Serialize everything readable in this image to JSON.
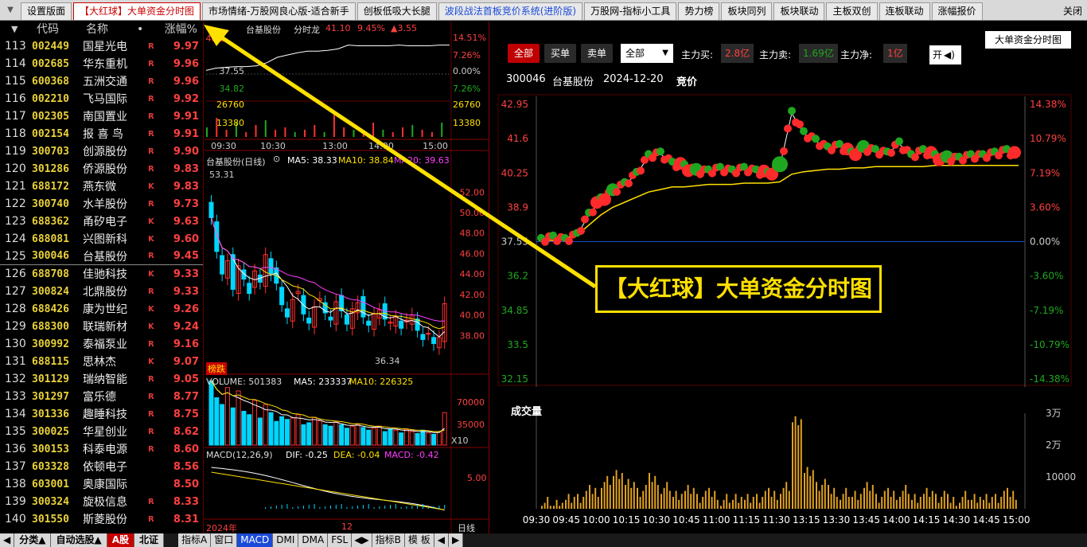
{
  "tabs": [
    {
      "label": "设置版面",
      "state": "normal"
    },
    {
      "label": "【大红球】大单资金分时图",
      "state": "active"
    },
    {
      "label": "市场情绪-万股网良心版-适合新手",
      "state": "normal"
    },
    {
      "label": "创板低吸大长腿",
      "state": "normal"
    },
    {
      "label": "波段战法首板竞价系统(进阶版)",
      "state": "blue"
    },
    {
      "label": "万股网-指标小工具",
      "state": "normal"
    },
    {
      "label": "势力榜",
      "state": "normal"
    },
    {
      "label": "板块同列",
      "state": "normal"
    },
    {
      "label": "板块联动",
      "state": "normal"
    },
    {
      "label": "主板双创",
      "state": "normal"
    },
    {
      "label": "连板联动",
      "state": "normal"
    },
    {
      "label": "涨幅报价",
      "state": "normal"
    }
  ],
  "close_label": "关闭",
  "list": {
    "header": {
      "code": "代码",
      "name": "名称",
      "dot": "•",
      "pct": "涨幅%"
    },
    "rows": [
      {
        "no": "113",
        "code": "002449",
        "name": "国星光电",
        "flag": "R",
        "pct": "9.97"
      },
      {
        "no": "114",
        "code": "002685",
        "name": "华东重机",
        "flag": "R",
        "pct": "9.96"
      },
      {
        "no": "115",
        "code": "600368",
        "name": "五洲交通",
        "flag": "R",
        "pct": "9.96"
      },
      {
        "no": "116",
        "code": "002210",
        "name": "飞马国际",
        "flag": "R",
        "pct": "9.92"
      },
      {
        "no": "117",
        "code": "002305",
        "name": "南国置业",
        "flag": "R",
        "pct": "9.91"
      },
      {
        "no": "118",
        "code": "002154",
        "name": "报 喜 鸟",
        "flag": "R",
        "pct": "9.91"
      },
      {
        "no": "119",
        "code": "300703",
        "name": "创源股份",
        "flag": "R",
        "pct": "9.90"
      },
      {
        "no": "120",
        "code": "301286",
        "name": "侨源股份",
        "flag": "R",
        "pct": "9.83"
      },
      {
        "no": "121",
        "code": "688172",
        "name": "燕东微",
        "flag": "K",
        "pct": "9.83"
      },
      {
        "no": "122",
        "code": "300740",
        "name": "水羊股份",
        "flag": "R",
        "pct": "9.73"
      },
      {
        "no": "123",
        "code": "688362",
        "name": "甬矽电子",
        "flag": "K",
        "pct": "9.63"
      },
      {
        "no": "124",
        "code": "688081",
        "name": "兴图新科",
        "flag": "K",
        "pct": "9.60"
      },
      {
        "no": "125",
        "code": "300046",
        "name": "台基股份",
        "flag": "R",
        "pct": "9.45"
      },
      {
        "no": "126",
        "code": "688708",
        "name": "佳驰科技",
        "flag": "K",
        "pct": "9.33"
      },
      {
        "no": "127",
        "code": "300824",
        "name": "北鼎股份",
        "flag": "R",
        "pct": "9.33"
      },
      {
        "no": "128",
        "code": "688426",
        "name": "康为世纪",
        "flag": "K",
        "pct": "9.26"
      },
      {
        "no": "129",
        "code": "688300",
        "name": "联瑞新材",
        "flag": "K",
        "pct": "9.24"
      },
      {
        "no": "130",
        "code": "300992",
        "name": "泰福泵业",
        "flag": "R",
        "pct": "9.16"
      },
      {
        "no": "131",
        "code": "688115",
        "name": "思林杰",
        "flag": "K",
        "pct": "9.07"
      },
      {
        "no": "132",
        "code": "301129",
        "name": "瑞纳智能",
        "flag": "R",
        "pct": "9.05"
      },
      {
        "no": "133",
        "code": "301297",
        "name": "富乐德",
        "flag": "R",
        "pct": "8.77"
      },
      {
        "no": "134",
        "code": "301336",
        "name": "趣睡科技",
        "flag": "R",
        "pct": "8.75"
      },
      {
        "no": "135",
        "code": "300025",
        "name": "华星创业",
        "flag": "R",
        "pct": "8.62"
      },
      {
        "no": "136",
        "code": "300153",
        "name": "科泰电源",
        "flag": "R",
        "pct": "8.60"
      },
      {
        "no": "137",
        "code": "603328",
        "name": "依顿电子",
        "flag": "",
        "pct": "8.56"
      },
      {
        "no": "138",
        "code": "603001",
        "name": "奥康国际",
        "flag": "",
        "pct": "8.50"
      },
      {
        "no": "139",
        "code": "300324",
        "name": "旋极信息",
        "flag": "R",
        "pct": "8.33"
      },
      {
        "no": "140",
        "code": "301550",
        "name": "斯菱股份",
        "flag": "R",
        "pct": "8.31"
      }
    ]
  },
  "bottom": {
    "left": [
      "分类▲",
      "自动选股▲",
      "A股",
      "北证"
    ],
    "mid": [
      "指标A",
      "窗口",
      "MACD",
      "DMI",
      "DMA",
      "FSL",
      "指标B",
      "模 板"
    ]
  },
  "mini": {
    "title": "台基股份",
    "mode": "分时龙",
    "price": "41.10",
    "pct": "9.45%",
    "chg": "▲3.55",
    "left_prices": [
      "40.2",
      "37.55",
      "34.82"
    ],
    "left_vols": [
      "26760",
      "13380"
    ],
    "right_pcts": [
      "14.51%",
      "7.26%",
      "0.00%",
      "7.26%"
    ],
    "right_vols": [
      "26760",
      "13380"
    ],
    "times": [
      "09:30",
      "10:30",
      "13:00",
      "14:00",
      "15:00"
    ],
    "price_line": [
      37.8,
      38.1,
      38.2,
      38.3,
      38.3,
      38.4,
      38.8,
      39.5,
      39.8,
      40.1,
      40.3,
      40.3,
      40.4,
      40.6,
      41.1,
      41.0,
      41.0,
      41.0,
      41.0,
      41.1,
      41.0,
      41.0,
      41.0,
      41.1,
      41.1
    ],
    "vol_bars": [
      4,
      8,
      3,
      6,
      2,
      5,
      7,
      3,
      4,
      2,
      3,
      5,
      2,
      10,
      4,
      3,
      2,
      6,
      3,
      2,
      4,
      5,
      3,
      2,
      6
    ]
  },
  "kline": {
    "title": "台基股份(日线)",
    "ma5": "MA5: 38.33",
    "ma10": "MA10: 38.84",
    "ma20": "MA20: 39.63",
    "hi": "53.31",
    "lo": "36.34",
    "tag": "榜跌",
    "yticks": [
      "52.00",
      "50.00",
      "48.00",
      "46.00",
      "44.00",
      "42.00",
      "40.00",
      "38.00"
    ],
    "closes": [
      49.5,
      46.2,
      44.0,
      45.3,
      42.5,
      44.8,
      43.5,
      42.1,
      44.3,
      43.2,
      45.9,
      44.0,
      43.1,
      41.0,
      39.8,
      41.5,
      42.3,
      40.1,
      39.2,
      40.8,
      41.6,
      40.2,
      39.5,
      41.3,
      40.4,
      39.1,
      40.6,
      41.2,
      39.8,
      39.0,
      40.1,
      40.5,
      39.6,
      39.3,
      39.8,
      38.7,
      39.5,
      40.0,
      38.5,
      37.6,
      38.2,
      37.2,
      37.8,
      41.1
    ]
  },
  "vol": {
    "title": "VOLUME: 501383",
    "ma5": "MA5: 233337",
    "ma10": "MA10: 226325",
    "yticks": [
      "70000",
      "35000"
    ],
    "unit": "X10",
    "bars": [
      95,
      70,
      60,
      85,
      55,
      80,
      50,
      45,
      66,
      40,
      60,
      48,
      35,
      42,
      38,
      40,
      45,
      30,
      33,
      41,
      36,
      30,
      28,
      34,
      30,
      25,
      28,
      31,
      26,
      22,
      25,
      28,
      20,
      24,
      22,
      18,
      23,
      20,
      17,
      22,
      18,
      16,
      20,
      48
    ]
  },
  "macd": {
    "title": "MACD(12,26,9)",
    "dif": "DIF: -0.25",
    "dea": "DEA: -0.04",
    "macd": "MACD: -0.42",
    "ytick": "5.00",
    "xlabels": [
      "2024年",
      "12"
    ],
    "period": "日线"
  },
  "right": {
    "filters": [
      "全部",
      "买单",
      "卖单"
    ],
    "dropdown": "全部",
    "buy_label": "主力买:",
    "buy_val": "2.8亿",
    "sell_label": "主力卖:",
    "sell_val": "1.69亿",
    "net_label": "主力净:",
    "net_val": "1亿",
    "toggle": "开",
    "title_btn": "大单资金分时图",
    "stock_line": [
      "300046",
      "台基股份",
      "2024-12-20",
      "竞价"
    ],
    "left_ticks": [
      "42.95",
      "41.6",
      "40.25",
      "38.9",
      "37.55",
      "36.2",
      "34.85",
      "33.5",
      "32.15"
    ],
    "right_ticks": [
      "14.38%",
      "10.79%",
      "7.19%",
      "3.60%",
      "0.00%",
      "-3.60%",
      "-7.19%",
      "-10.79%",
      "-14.38%"
    ],
    "vol_title": "成交量",
    "vol_ticks": [
      "3万",
      "2万",
      "10000"
    ],
    "times": [
      "09:30",
      "09:45",
      "10:00",
      "10:15",
      "10:30",
      "10:45",
      "11:00",
      "11:15",
      "11:30",
      "13:15",
      "13:30",
      "13:45",
      "14:00",
      "14:15",
      "14:30",
      "14:45",
      "15:00"
    ],
    "price": [
      37.6,
      37.7,
      37.6,
      37.8,
      38.6,
      39.2,
      39.5,
      39.8,
      40.2,
      40.9,
      41.0,
      40.6,
      40.5,
      40.3,
      40.3,
      40.4,
      40.3,
      40.4,
      40.3,
      40.2,
      40.5,
      42.6,
      41.8,
      41.5,
      41.2,
      41.3,
      41.0,
      41.2,
      41.1,
      41.0,
      41.4,
      40.9,
      41.1,
      40.9,
      40.8,
      40.8,
      40.9,
      40.9,
      41.0,
      41.1,
      40.9
    ],
    "avg": [
      37.6,
      37.6,
      37.7,
      37.8,
      38.2,
      38.6,
      38.9,
      39.1,
      39.3,
      39.5,
      39.6,
      39.7,
      39.7,
      39.75,
      39.8,
      39.8,
      39.8,
      39.85,
      39.85,
      39.85,
      39.9,
      40.2,
      40.3,
      40.35,
      40.4,
      40.4,
      40.45,
      40.45,
      40.5,
      40.5,
      40.5,
      40.5,
      40.5,
      40.55,
      40.55,
      40.55,
      40.55,
      40.55,
      40.55,
      40.55,
      40.55
    ],
    "vol_bars": [
      2,
      2,
      3,
      4,
      6,
      9,
      12,
      8,
      6,
      10,
      7,
      5,
      6,
      4,
      5,
      3,
      4,
      3,
      4,
      5,
      7,
      30,
      12,
      8,
      6,
      5,
      5,
      7,
      4,
      5,
      6,
      4,
      5,
      4,
      3,
      4,
      4,
      3,
      4,
      5,
      6
    ]
  },
  "callout": "【大红球】大单资金分时图",
  "colors": {
    "red": "#ff2a2a",
    "green": "#1fa81f",
    "yellow": "#ffe000",
    "cyan": "#00d6ff",
    "magenta": "#ff3cff"
  }
}
